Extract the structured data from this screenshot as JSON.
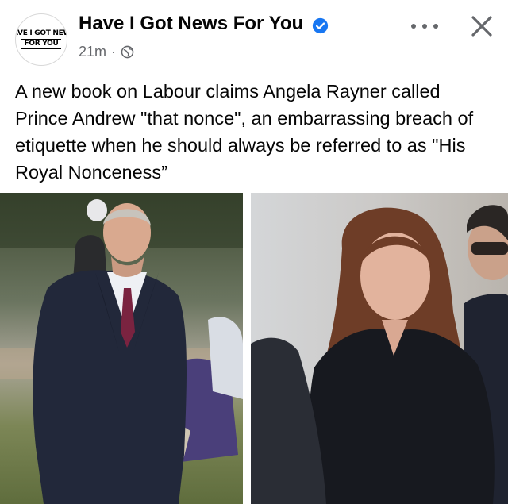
{
  "post": {
    "page_name": "Have I Got News For You",
    "verified_icon": "verified-badge-icon",
    "time": "21m",
    "separator": "·",
    "audience_icon": "globe-icon",
    "avatar_logo": {
      "line1": "HAVE I GOT NEWS",
      "line2": "FOR YOU"
    },
    "text": "A new book on Labour claims Angela Rayner called Prince Andrew \"that nonce\", an embarrassing breach of etiquette when he should always be referred to as \"His Royal Nonceness”",
    "images": [
      {
        "icon": "photo-man-in-overcoat"
      },
      {
        "icon": "photo-woman-in-black-coat"
      }
    ]
  },
  "actions": {
    "more_icon": "more-options-icon",
    "close_icon": "close-icon"
  },
  "colors": {
    "text": "#050505",
    "meta": "#65676b",
    "verified": "#1877f2"
  }
}
